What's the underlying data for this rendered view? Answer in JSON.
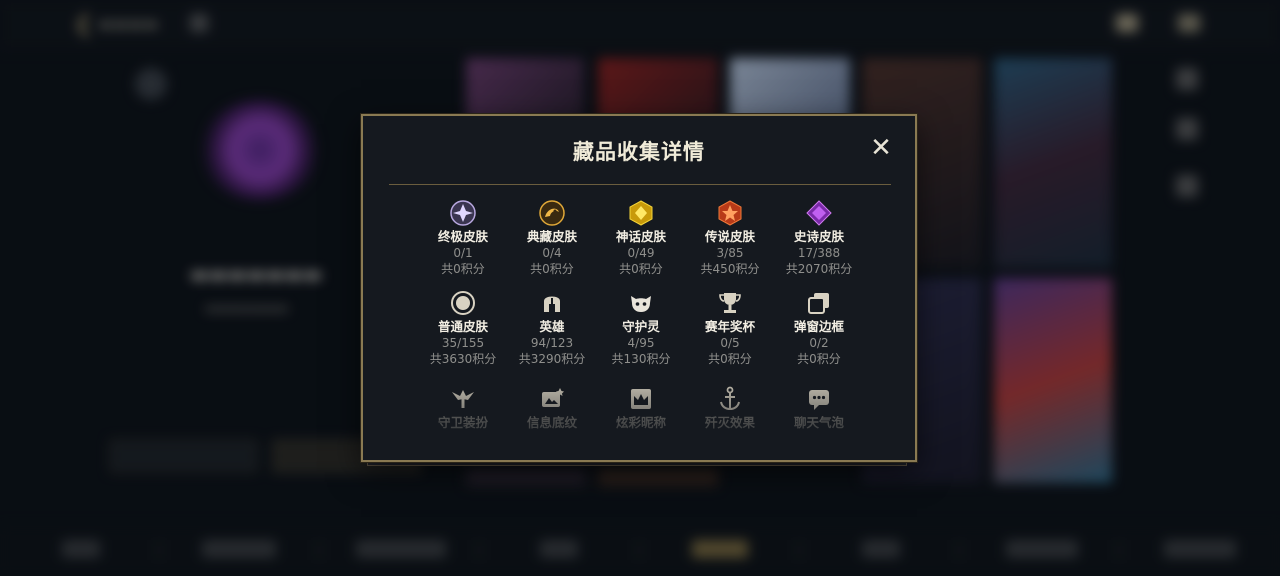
{
  "modal": {
    "title": "藏品收集详情",
    "close_label": "✕"
  },
  "items": [
    {
      "label": "终极皮肤",
      "count": "0/1",
      "points": "共0积分",
      "icon": "ultimate-skin-icon",
      "color": "#c9b8f0"
    },
    {
      "label": "典藏皮肤",
      "count": "0/4",
      "points": "共0积分",
      "icon": "prestige-skin-icon",
      "color": "#d9a53a"
    },
    {
      "label": "神话皮肤",
      "count": "0/49",
      "points": "共0积分",
      "icon": "mythic-skin-icon",
      "color": "#e8c21e"
    },
    {
      "label": "传说皮肤",
      "count": "3/85",
      "points": "共450积分",
      "icon": "legendary-skin-icon",
      "color": "#e8652a"
    },
    {
      "label": "史诗皮肤",
      "count": "17/388",
      "points": "共2070积分",
      "icon": "epic-skin-icon",
      "color": "#b45ae0"
    },
    {
      "label": "普通皮肤",
      "count": "35/155",
      "points": "共3630积分",
      "icon": "standard-skin-icon",
      "color": "#d8d2c2"
    },
    {
      "label": "英雄",
      "count": "94/123",
      "points": "共3290积分",
      "icon": "champion-helmet-icon",
      "color": "#d8d2c2"
    },
    {
      "label": "守护灵",
      "count": "4/95",
      "points": "共130积分",
      "icon": "guardian-pet-icon",
      "color": "#e8e4da"
    },
    {
      "label": "赛年奖杯",
      "count": "0/5",
      "points": "共0积分",
      "icon": "trophy-icon",
      "color": "#d8d2c2"
    },
    {
      "label": "弹窗边框",
      "count": "0/2",
      "points": "共0积分",
      "icon": "popup-frame-icon",
      "color": "#d8d2c2"
    },
    {
      "label": "守卫装扮",
      "icon": "ward-skin-icon",
      "color": "#b8b3a6"
    },
    {
      "label": "信息底纹",
      "icon": "info-banner-icon",
      "color": "#b8b3a6"
    },
    {
      "label": "炫彩昵称",
      "icon": "colorful-nickname-icon",
      "color": "#b8b3a6"
    },
    {
      "label": "歼灭效果",
      "icon": "kill-effect-icon",
      "color": "#b8b3a6"
    },
    {
      "label": "聊天气泡",
      "icon": "chat-bubble-icon",
      "color": "#b8b3a6"
    }
  ]
}
